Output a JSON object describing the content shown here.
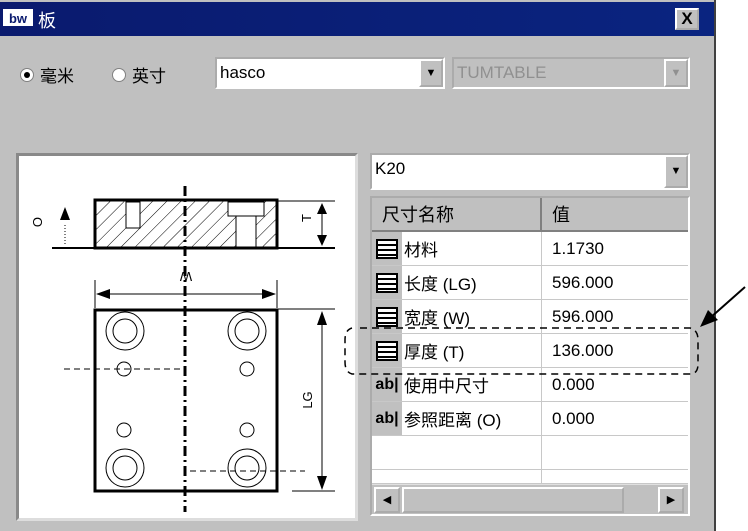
{
  "window": {
    "title": "板",
    "logo": "bw",
    "close": "X"
  },
  "units": [
    {
      "label": "毫米",
      "selected": true
    },
    {
      "label": "英寸",
      "selected": false
    }
  ],
  "catalog_combo": {
    "value": "hasco"
  },
  "type_combo": {
    "value": "TUMTABLE",
    "disabled": true
  },
  "drawing": {
    "labels": {
      "O": "O",
      "T": "T",
      "W": "W",
      "LG": "LG"
    }
  },
  "part_combo": {
    "value": "K20"
  },
  "table": {
    "headers": [
      "尺寸名称",
      "值"
    ],
    "rows": [
      {
        "icon": "table-icon",
        "name": "材料",
        "value": "1.1730"
      },
      {
        "icon": "table-icon",
        "name": "长度 (LG)",
        "value": "596.000"
      },
      {
        "icon": "table-icon",
        "name": "宽度 (W)",
        "value": "596.000"
      },
      {
        "icon": "table-icon",
        "name": "厚度 (T)",
        "value": "136.000"
      },
      {
        "icon": "ab-icon",
        "icon_text": "ab|",
        "name": "使用中尺寸",
        "value": "0.000"
      },
      {
        "icon": "ab-icon",
        "icon_text": "ab|",
        "name": "参照距离 (O)",
        "value": "0.000"
      }
    ]
  }
}
